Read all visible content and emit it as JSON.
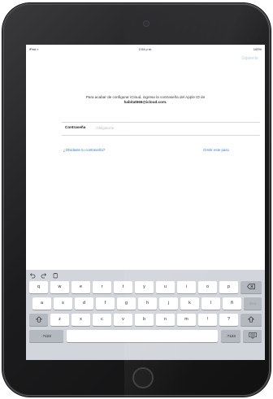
{
  "status_bar": {
    "left": "iPad ≈",
    "time": "2:04 p.m.",
    "right": "100%"
  },
  "nav": {
    "next_label": "Siguiente"
  },
  "prompt": {
    "text": "Para acabar de configurar iCloud, ingresa la contraseña del Apple ID de",
    "email": "habitat666@icloud.com."
  },
  "password": {
    "label": "Contraseña",
    "placeholder": "Obligatorio"
  },
  "links": {
    "forgot": "¿Olvidaste tu contraseña?",
    "skip": "Omitir este paso"
  },
  "keyboard": {
    "toolbar": [
      "undo-icon",
      "redo-icon",
      "paste-icon"
    ],
    "row1": [
      "q",
      "w",
      "e",
      "r",
      "t",
      "y",
      "u",
      "i",
      "o",
      "p"
    ],
    "row2": [
      "a",
      "s",
      "d",
      "f",
      "g",
      "h",
      "j",
      "k",
      "l",
      "ñ"
    ],
    "row2_action": "Intro",
    "row3": [
      "z",
      "x",
      "c",
      "v",
      "b",
      "n",
      "m"
    ],
    "row3_punct": [
      {
        "main": "!",
        "sub": ","
      },
      {
        "main": "?",
        "sub": "."
      }
    ],
    "num_key": ".?123",
    "icons": [
      "delete-icon",
      "shift-icon",
      "shift-icon",
      "keyboard-dismiss-icon"
    ]
  }
}
